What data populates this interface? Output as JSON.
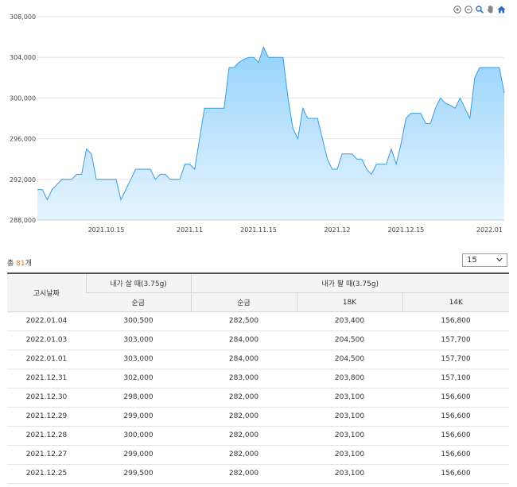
{
  "chart_data": {
    "type": "area",
    "y_ticks": [
      "308,000",
      "304,000",
      "300,000",
      "296,000",
      "292,000",
      "288,000"
    ],
    "y_tick_values": [
      308000,
      304000,
      300000,
      296000,
      292000,
      288000
    ],
    "ylim": [
      288000,
      308000
    ],
    "x_ticks": [
      {
        "label": "2021.10.15",
        "date": "2021-10-15"
      },
      {
        "label": "2021.11",
        "date": "2021-11-01"
      },
      {
        "label": "2021.11.15",
        "date": "2021-11-15"
      },
      {
        "label": "2021.12",
        "date": "2021-12-01"
      },
      {
        "label": "2021.12.15",
        "date": "2021-12-15"
      },
      {
        "label": "2022.01",
        "date": "2022-01-01"
      }
    ],
    "xlim": [
      "2021-10-01",
      "2022-01-04"
    ],
    "grid": true,
    "fill_color": "#cfe9fb",
    "line_color": "#3a9de0",
    "points": [
      [
        "2021-10-01",
        291000
      ],
      [
        "2021-10-02",
        291000
      ],
      [
        "2021-10-03",
        290000
      ],
      [
        "2021-10-04",
        291000
      ],
      [
        "2021-10-05",
        291500
      ],
      [
        "2021-10-06",
        292000
      ],
      [
        "2021-10-07",
        292000
      ],
      [
        "2021-10-08",
        292000
      ],
      [
        "2021-10-09",
        292500
      ],
      [
        "2021-10-10",
        292500
      ],
      [
        "2021-10-11",
        295000
      ],
      [
        "2021-10-12",
        294500
      ],
      [
        "2021-10-13",
        292000
      ],
      [
        "2021-10-14",
        292000
      ],
      [
        "2021-10-15",
        292000
      ],
      [
        "2021-10-16",
        292000
      ],
      [
        "2021-10-17",
        292000
      ],
      [
        "2021-10-18",
        290000
      ],
      [
        "2021-10-19",
        291000
      ],
      [
        "2021-10-20",
        292000
      ],
      [
        "2021-10-21",
        293000
      ],
      [
        "2021-10-22",
        293000
      ],
      [
        "2021-10-23",
        293000
      ],
      [
        "2021-10-24",
        293000
      ],
      [
        "2021-10-25",
        292000
      ],
      [
        "2021-10-26",
        292500
      ],
      [
        "2021-10-27",
        292500
      ],
      [
        "2021-10-28",
        292000
      ],
      [
        "2021-10-29",
        292000
      ],
      [
        "2021-10-30",
        292000
      ],
      [
        "2021-10-31",
        293500
      ],
      [
        "2021-11-01",
        293500
      ],
      [
        "2021-11-02",
        293000
      ],
      [
        "2021-11-03",
        296000
      ],
      [
        "2021-11-04",
        299000
      ],
      [
        "2021-11-05",
        299000
      ],
      [
        "2021-11-06",
        299000
      ],
      [
        "2021-11-07",
        299000
      ],
      [
        "2021-11-08",
        299000
      ],
      [
        "2021-11-09",
        303000
      ],
      [
        "2021-11-10",
        303000
      ],
      [
        "2021-11-11",
        303500
      ],
      [
        "2021-11-12",
        303800
      ],
      [
        "2021-11-13",
        304000
      ],
      [
        "2021-11-14",
        304000
      ],
      [
        "2021-11-15",
        303500
      ],
      [
        "2021-11-16",
        305000
      ],
      [
        "2021-11-17",
        304000
      ],
      [
        "2021-11-18",
        304000
      ],
      [
        "2021-11-19",
        304000
      ],
      [
        "2021-11-20",
        304000
      ],
      [
        "2021-11-21",
        300000
      ],
      [
        "2021-11-22",
        297000
      ],
      [
        "2021-11-23",
        296000
      ],
      [
        "2021-11-24",
        299000
      ],
      [
        "2021-11-25",
        298000
      ],
      [
        "2021-11-26",
        298000
      ],
      [
        "2021-11-27",
        298000
      ],
      [
        "2021-11-28",
        296000
      ],
      [
        "2021-11-29",
        294000
      ],
      [
        "2021-11-30",
        293000
      ],
      [
        "2021-12-01",
        293000
      ],
      [
        "2021-12-02",
        294500
      ],
      [
        "2021-12-03",
        294500
      ],
      [
        "2021-12-04",
        294500
      ],
      [
        "2021-12-05",
        294000
      ],
      [
        "2021-12-06",
        294000
      ],
      [
        "2021-12-07",
        293000
      ],
      [
        "2021-12-08",
        292500
      ],
      [
        "2021-12-09",
        293500
      ],
      [
        "2021-12-10",
        293500
      ],
      [
        "2021-12-11",
        293500
      ],
      [
        "2021-12-12",
        295000
      ],
      [
        "2021-12-13",
        293500
      ],
      [
        "2021-12-14",
        295500
      ],
      [
        "2021-12-15",
        298000
      ],
      [
        "2021-12-16",
        298500
      ],
      [
        "2021-12-17",
        298500
      ],
      [
        "2021-12-18",
        298500
      ],
      [
        "2021-12-19",
        297500
      ],
      [
        "2021-12-20",
        297500
      ],
      [
        "2021-12-21",
        299000
      ],
      [
        "2021-12-22",
        300000
      ],
      [
        "2021-12-23",
        299500
      ],
      [
        "2021-12-24",
        299300
      ],
      [
        "2021-12-25",
        299000
      ],
      [
        "2021-12-26",
        300000
      ],
      [
        "2021-12-27",
        299000
      ],
      [
        "2021-12-28",
        298000
      ],
      [
        "2021-12-29",
        302000
      ],
      [
        "2021-12-30",
        303000
      ],
      [
        "2021-12-31",
        303000
      ],
      [
        "2022-01-01",
        303000
      ],
      [
        "2022-01-03",
        303000
      ],
      [
        "2022-01-04",
        300500
      ]
    ]
  },
  "toolbar": {
    "icons": [
      "zoom-in-icon",
      "zoom-out-icon",
      "magnifier-icon",
      "pan-hand-icon",
      "home-icon"
    ]
  },
  "summary": {
    "prefix": "총 ",
    "count": "81",
    "suffix": "개"
  },
  "page_size_select": {
    "value": "15"
  },
  "table": {
    "head_row1": {
      "date": "고시날짜",
      "buy": "내가 살 때(3.75g)",
      "sell": "내가 팔 때(3.75g)"
    },
    "head_row2": {
      "buy_pure": "순금",
      "sell_pure": "순금",
      "sell_18k": "18K",
      "sell_14k": "14K"
    },
    "rows": [
      [
        "2022.01.04",
        "300,500",
        "282,500",
        "203,400",
        "156,800"
      ],
      [
        "2022.01.03",
        "303,000",
        "284,000",
        "204,500",
        "157,700"
      ],
      [
        "2022.01.01",
        "303,000",
        "284,000",
        "204,500",
        "157,700"
      ],
      [
        "2021.12.31",
        "302,000",
        "283,000",
        "203,800",
        "157,100"
      ],
      [
        "2021.12.30",
        "298,000",
        "282,000",
        "203,100",
        "156,600"
      ],
      [
        "2021.12.29",
        "299,000",
        "282,000",
        "203,100",
        "156,600"
      ],
      [
        "2021.12.28",
        "300,000",
        "282,000",
        "203,100",
        "156,600"
      ],
      [
        "2021.12.27",
        "299,000",
        "282,000",
        "203,100",
        "156,600"
      ],
      [
        "2021.12.25",
        "299,500",
        "282,000",
        "203,100",
        "156,600"
      ]
    ]
  }
}
